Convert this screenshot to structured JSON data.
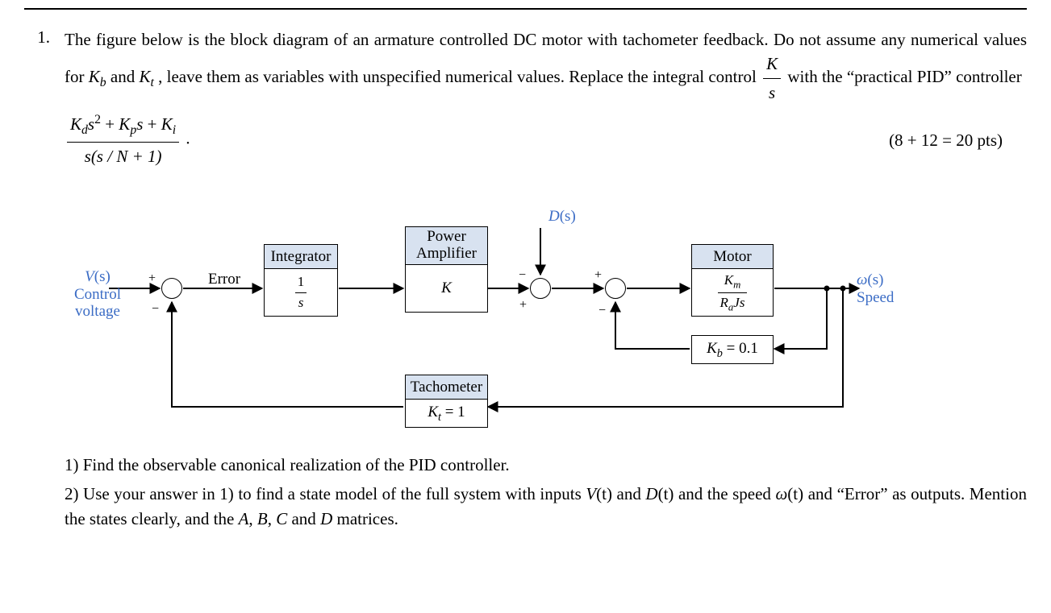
{
  "problem": {
    "number": "1.",
    "intro": "The figure below is the block diagram of an armature controlled DC motor with tachometer feedback. Do not assume any numerical values for ",
    "kb": "K",
    "kb_sub": "b",
    "and": " and ",
    "kt": "K",
    "kt_sub": "t",
    "intro2": ", leave them as variables with unspecified numerical values. Replace the integral control ",
    "integral_num": "K",
    "integral_den": "s",
    "intro3": " with the “practical PID” controller",
    "pid_num_1": "K",
    "pid_num_1_sub": "d",
    "pid_num_s2": "s",
    "pid_num_exp": "2",
    "pid_num_plus1": " + ",
    "pid_num_2": "K",
    "pid_num_2_sub": "p",
    "pid_num_s1": "s",
    "pid_num_plus2": " + ",
    "pid_num_3": "K",
    "pid_num_3_sub": "i",
    "pid_den": "s(s / N + 1)",
    "period": ".",
    "points": "(8 + 12 = 20 pts)"
  },
  "diagram": {
    "input_label_1": "V",
    "input_label_1_s": "(s)",
    "input_label_2": "Control",
    "input_label_3": "voltage",
    "error_label": "Error",
    "sum1_plus": "+",
    "sum1_minus": "−",
    "integrator_title": "Integrator",
    "integrator_num": "1",
    "integrator_den": "s",
    "amp_title_1": "Power",
    "amp_title_2": "Amplifier",
    "amp_body": "K",
    "disturb_label": "D",
    "disturb_label_s": "(s)",
    "sum2_plus": "+",
    "sum2_minus": "−",
    "sum3_plus": "+",
    "sum3_minus": "−",
    "motor_title": "Motor",
    "motor_num": "K",
    "motor_num_sub": "m",
    "motor_den_1": "R",
    "motor_den_1_sub": "a",
    "motor_den_2": "J",
    "motor_den_3": "s",
    "output_label_1": "ω",
    "output_label_1_s": "(s)",
    "output_label_2": "Speed",
    "backemf_body": "K",
    "backemf_sub": "b",
    "backemf_eq": " = 0.1",
    "tacho_title": "Tachometer",
    "tacho_body": "K",
    "tacho_sub": "t",
    "tacho_eq": " = 1"
  },
  "subproblems": {
    "q1": "1) Find the observable canonical realization of the PID controller.",
    "q2_a": "2) Use your answer in 1) to find a state model of the full system with inputs ",
    "q2_v": "V",
    "q2_vt": "(t)",
    "q2_and": " and ",
    "q2_d": "D",
    "q2_dt": "(t)",
    "q2_b": " and the speed ",
    "q2_omega": "ω",
    "q2_ot": "(t)",
    "q2_c": " and “Error” as outputs. Mention the states clearly, and the ",
    "q2_A": "A",
    "q2_comma1": ", ",
    "q2_B": "B",
    "q2_comma2": ", ",
    "q2_C": "C",
    "q2_and2": " and ",
    "q2_D": "D",
    "q2_end": " matrices."
  }
}
